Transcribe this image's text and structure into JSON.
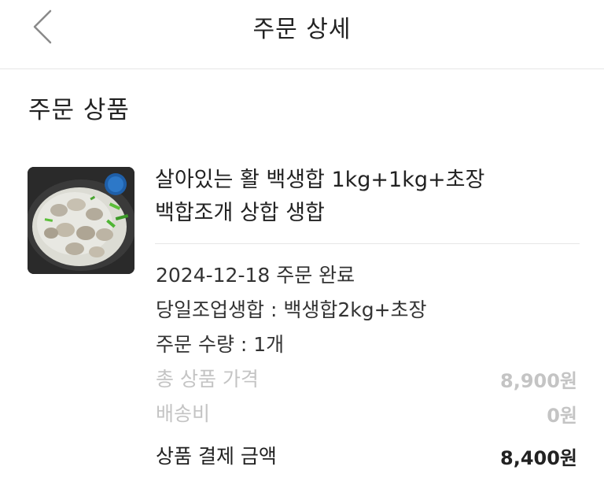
{
  "header": {
    "title": "주문 상세",
    "back_icon": "chevron-left-icon"
  },
  "section": {
    "title": "주문 상품"
  },
  "product": {
    "name_line1": "살아있는 활 백생합 1kg+1kg+초장",
    "name_line2": "백합조개 상합 생합",
    "order_status": "2024-12-18 주문 완료",
    "option": "당일조업생합 : 백생합2kg+초장",
    "quantity": "주문 수량 : 1개"
  },
  "pricing": {
    "total_label": "총 상품 가격",
    "total_value": "8,900원",
    "shipping_label": "배송비",
    "shipping_value": "0원",
    "payment_label": "상품 결제 금액",
    "payment_value": "8,400원"
  },
  "colors": {
    "text": "#222222",
    "muted": "#c4c4c4",
    "divider": "#e6e6e6"
  }
}
